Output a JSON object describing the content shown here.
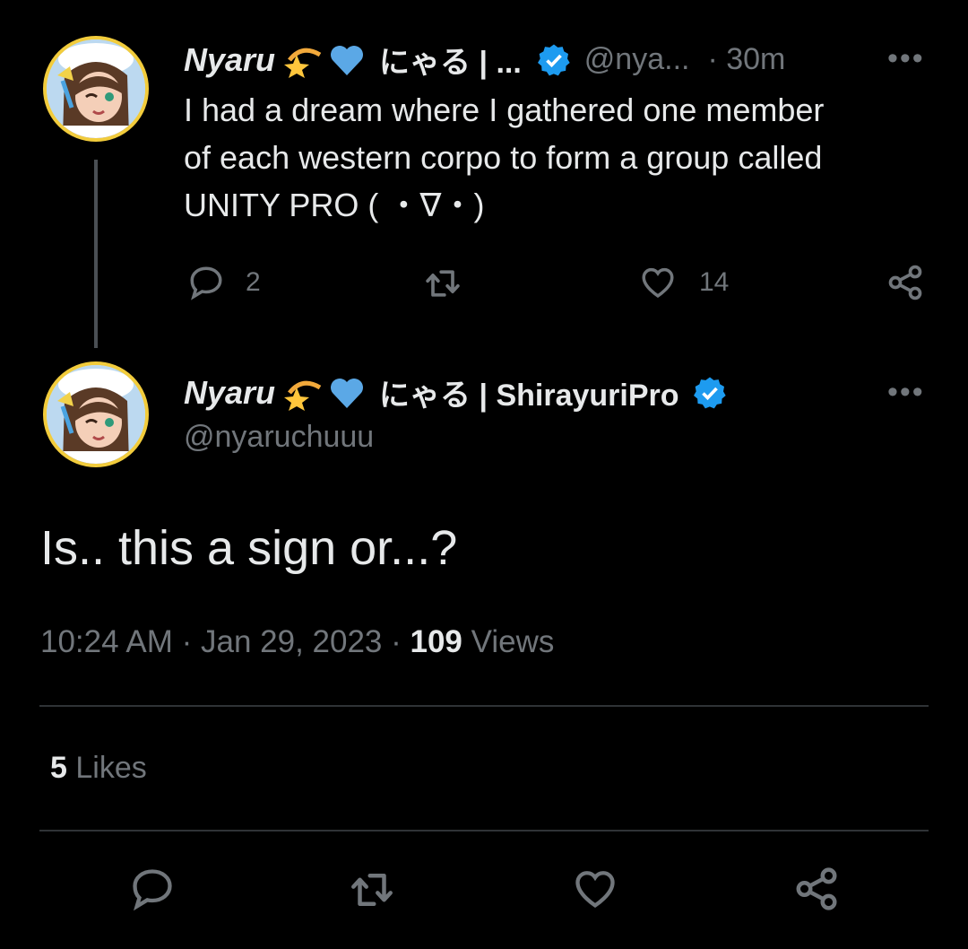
{
  "reply_tweet": {
    "display_name": "Nyaru",
    "display_name_jp": "にゃる | ...",
    "handle": "@nya...",
    "time_ago": "· 30m",
    "more": "•••",
    "text_line1": "I had a dream where I gathered one member",
    "text_line2": "of each western corpo to form a group called",
    "text_line3": "UNITY PRO ( ・∇・)",
    "reply_count": "2",
    "retweet_count": "",
    "like_count": "14"
  },
  "main_tweet": {
    "display_name": "Nyaru",
    "display_name_jp": "にゃる | ShirayuriPro",
    "handle": "@nyaruchuuu",
    "more": "•••",
    "text": "Is.. this a sign or...?",
    "timestamp": "10:24 AM · Jan 29, 2023 · ",
    "views_count": "109",
    "views_label": " Views",
    "likes_count": "5",
    "likes_label": " Likes"
  },
  "colors": {
    "background": "#000000",
    "text": "#e7e9ea",
    "muted": "#71767b",
    "verified": "#1d9bf0",
    "avatar_border": "#f2cc3c"
  },
  "icons": [
    "reply-icon",
    "retweet-icon",
    "like-icon",
    "share-icon",
    "verified-badge-icon",
    "dizzy-star-emoji",
    "blue-heart-emoji"
  ]
}
